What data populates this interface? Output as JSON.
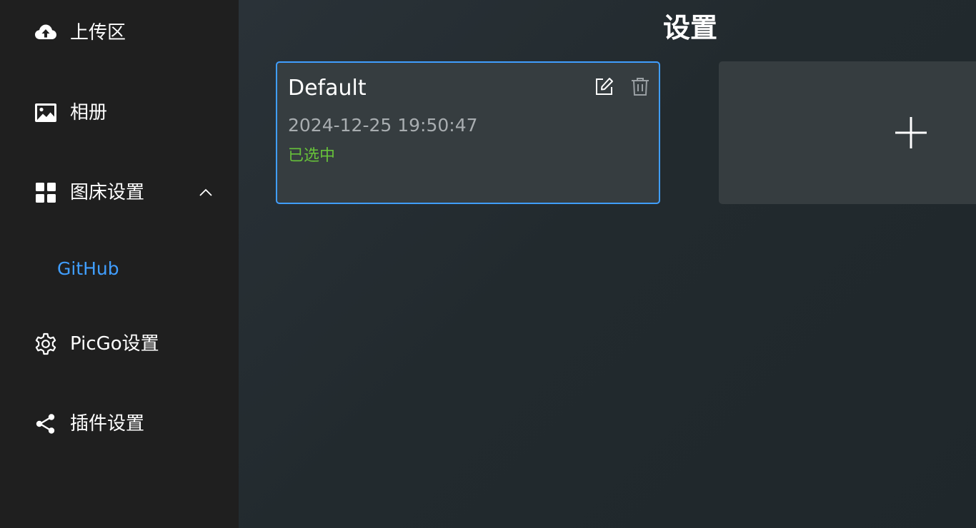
{
  "sidebar": {
    "items": [
      {
        "label": "上传区",
        "icon": "cloud-upload-icon"
      },
      {
        "label": "相册",
        "icon": "image-icon"
      },
      {
        "label": "图床设置",
        "icon": "grid-icon",
        "expanded": true
      },
      {
        "label": "PicGo设置",
        "icon": "gear-icon"
      },
      {
        "label": "插件设置",
        "icon": "share-icon"
      }
    ],
    "sub_items": [
      {
        "label": "GitHub",
        "active": true
      }
    ]
  },
  "main": {
    "title": "设置",
    "configs": [
      {
        "name": "Default",
        "date": "2024-12-25 19:50:47",
        "status": "已选中",
        "selected": true
      }
    ],
    "add_icon": "plus-icon"
  },
  "colors": {
    "accent": "#409eff",
    "selected_status": "#67c23a",
    "sidebar_bg": "#1f1f1f",
    "card_bg": "#363d40"
  }
}
